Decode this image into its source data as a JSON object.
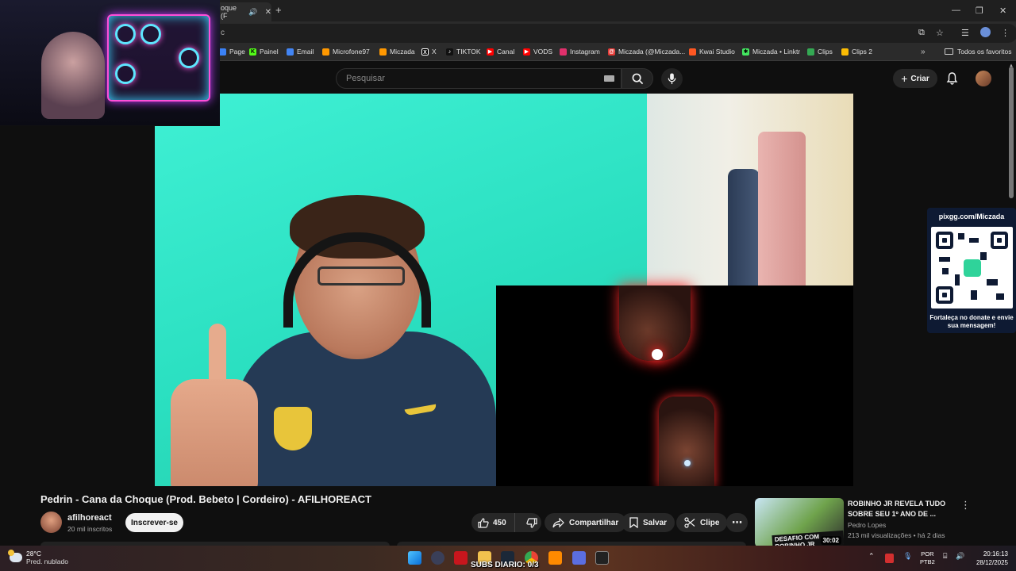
{
  "browser": {
    "tab_title": "oque (F",
    "address_text": "c",
    "bookmarks": [
      {
        "label": "Page",
        "icon": "page-icon",
        "color": "#3b82f6"
      },
      {
        "label": "Painel",
        "icon": "kick-icon",
        "color": "#53fc18"
      },
      {
        "label": "Email",
        "icon": "email-icon",
        "color": "#4285f4"
      },
      {
        "label": "Microfone97",
        "icon": "link-icon",
        "color": "#ff9800"
      },
      {
        "label": "Miczada",
        "icon": "link-icon",
        "color": "#ff9800"
      },
      {
        "label": "X",
        "icon": "x-icon",
        "color": "#ffffff"
      },
      {
        "label": "TIKTOK",
        "icon": "tiktok-icon",
        "color": "#ffffff"
      },
      {
        "label": "Canal",
        "icon": "youtube-icon",
        "color": "#ff0000"
      },
      {
        "label": "VODS",
        "icon": "youtube-icon",
        "color": "#ff0000"
      },
      {
        "label": "Instagram",
        "icon": "instagram-icon",
        "color": "#e1306c"
      },
      {
        "label": "Miczada (@Miczada...",
        "icon": "threads-icon",
        "color": "#e53935"
      },
      {
        "label": "Kwai Studio",
        "icon": "kwai-icon",
        "color": "#ff5722"
      },
      {
        "label": "Miczada • Linktr",
        "icon": "linktree-icon",
        "color": "#43e660"
      },
      {
        "label": "Clips",
        "icon": "drive-icon",
        "color": "#34a853"
      },
      {
        "label": "Clips 2",
        "icon": "drive-icon",
        "color": "#fbbc04"
      }
    ],
    "all_favorites_label": "Todos os favoritos"
  },
  "youtube": {
    "search_placeholder": "Pesquisar",
    "create_label": "Criar",
    "video_title": "Pedrin - Cana da Choque (Prod. Bebeto | Cordeiro) - AFILHOREACT",
    "channel_name": "afilhoreact",
    "channel_subs": "20 mil inscritos",
    "subscribe_label": "Inscrever-se",
    "like_count": "450",
    "share_label": "Compartilhar",
    "save_label": "Salvar",
    "clip_label": "Clipe",
    "recommendation": {
      "title": "ROBINHO JR REVELA TUDO SOBRE SEU 1º ANO DE ...",
      "channel": "Pedro Lopes",
      "meta": "213 mil visualizações • há 2 dias",
      "duration": "30:02",
      "thumb_text": "DESAFIO COM ROBINHO JR"
    }
  },
  "donate_panel": {
    "url": "pixgg.com/Miczada",
    "message": "Fortaleça no donate e envie sua mensagem!"
  },
  "taskbar": {
    "temperature": "28°C",
    "weather_desc": "Pred. nublado",
    "overlay_text": "SUBS DIARIO: 0/3",
    "lang_top": "POR",
    "lang_bottom": "PTB2",
    "time": "20:16:13",
    "date": "28/12/2025"
  }
}
